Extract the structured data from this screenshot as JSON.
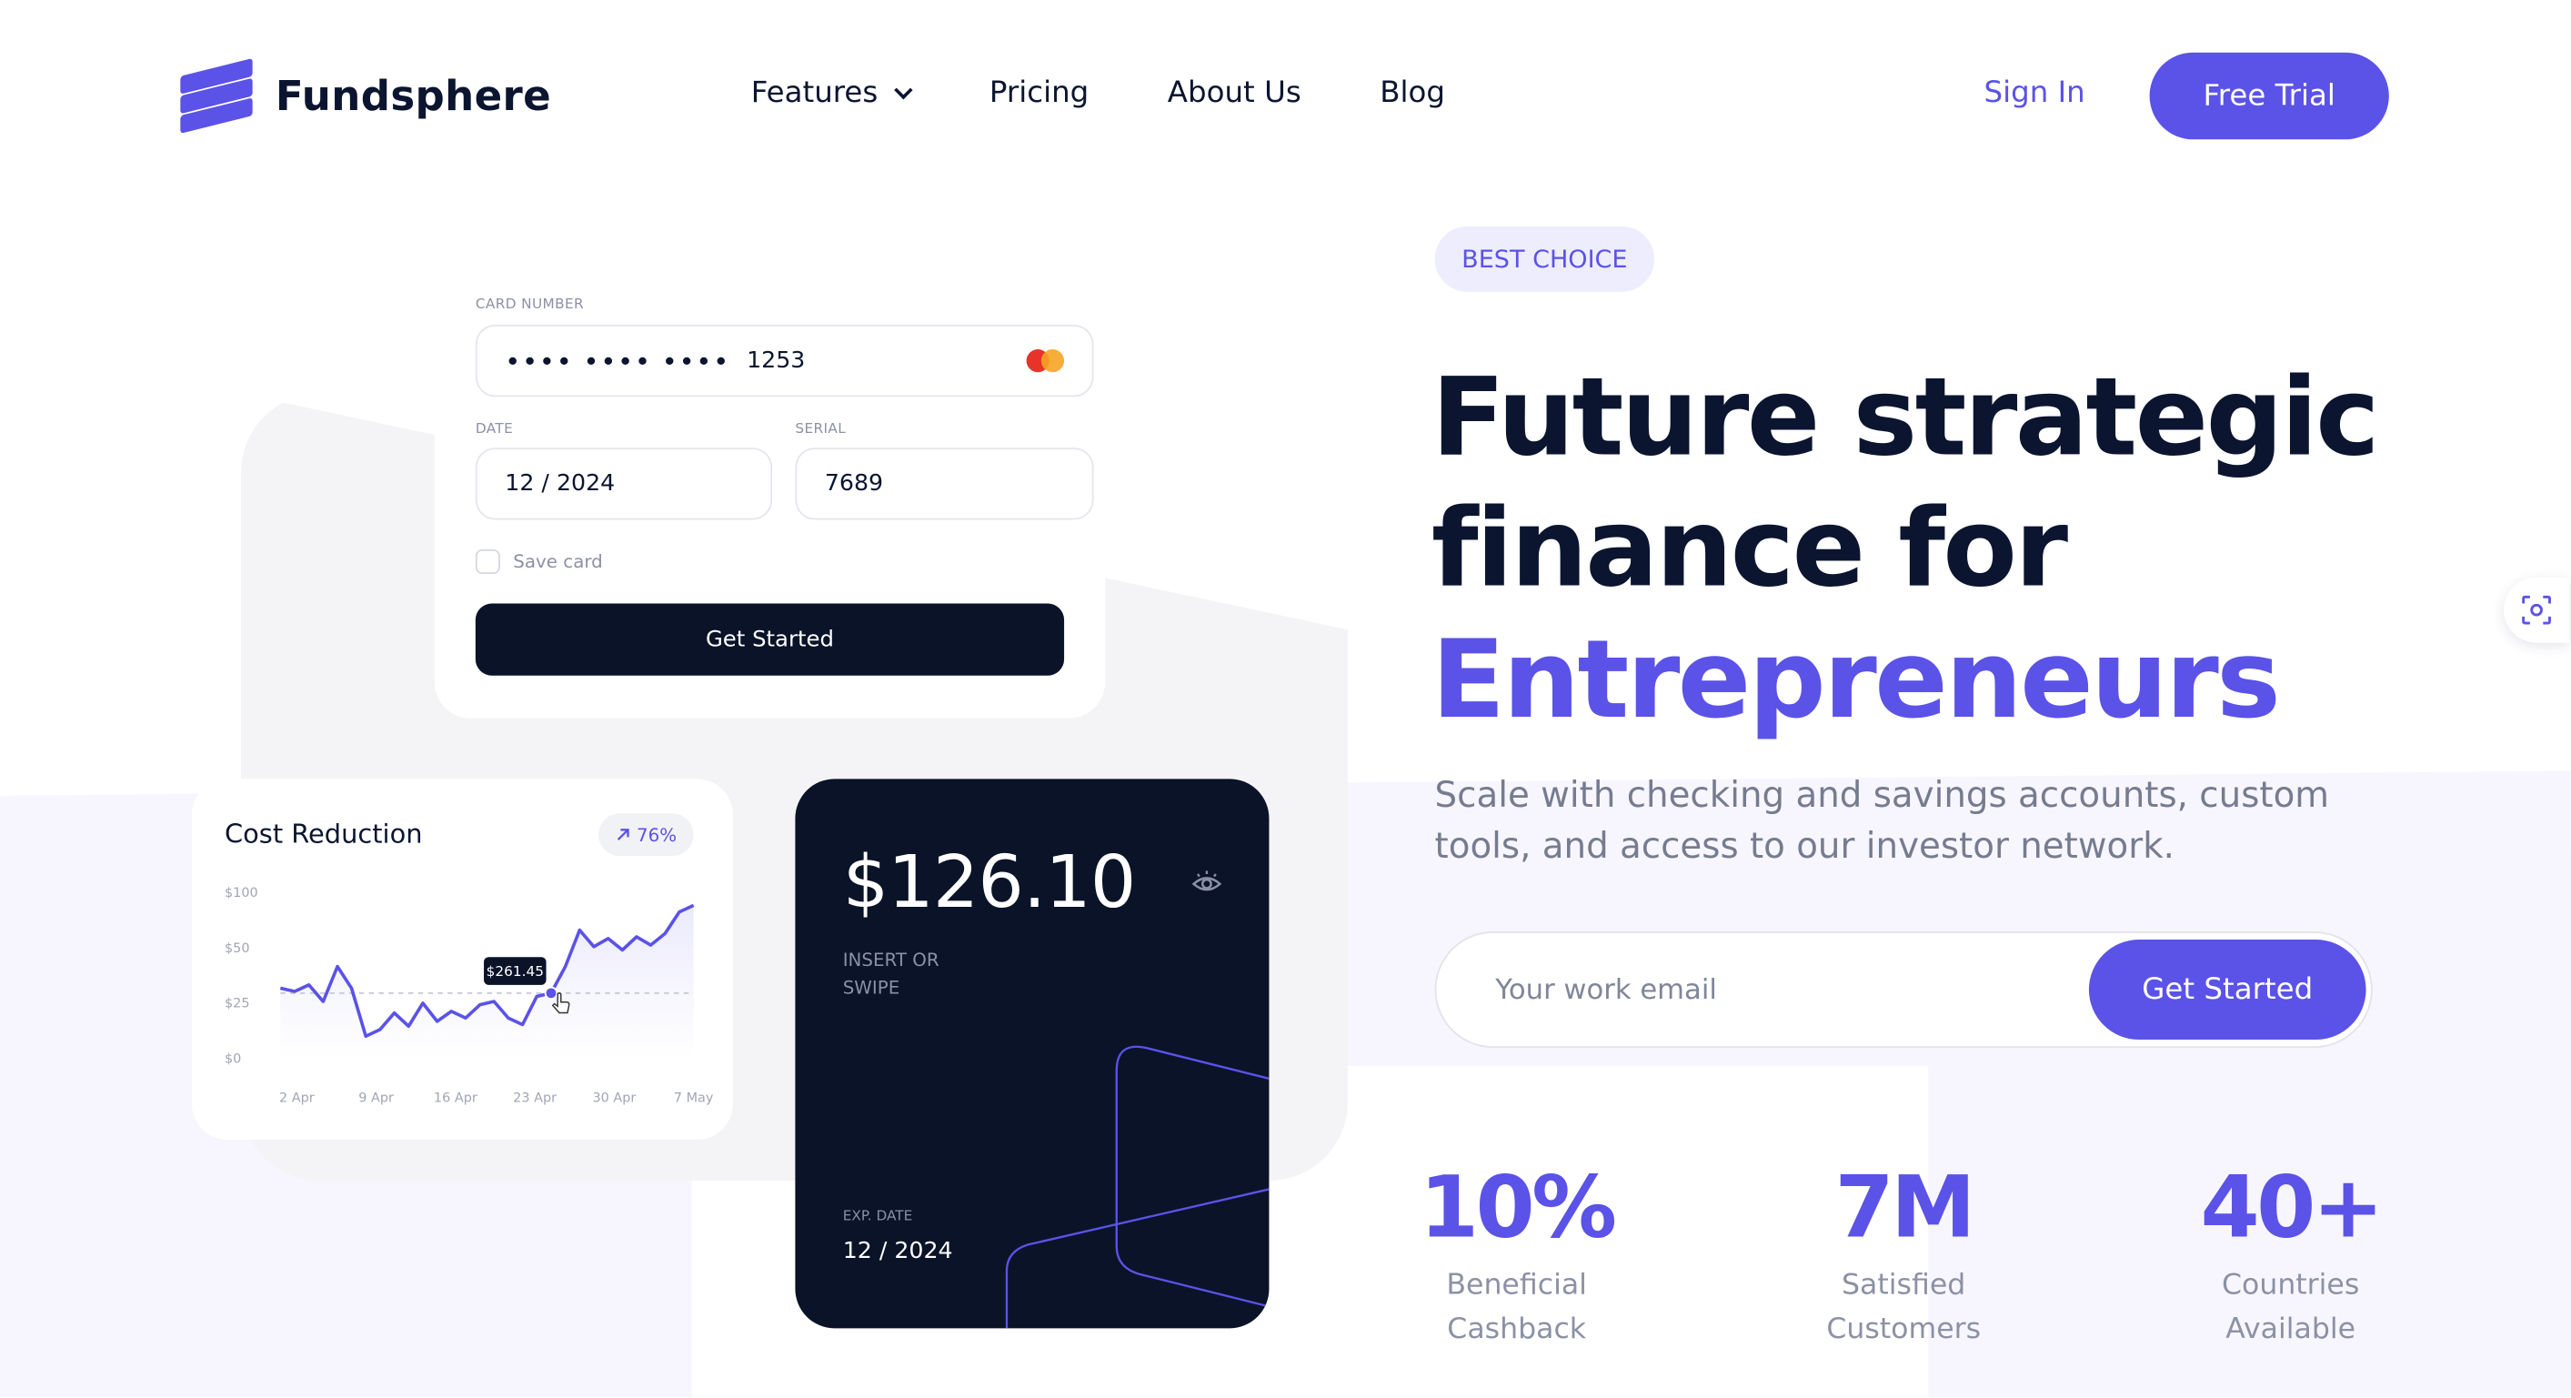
{
  "brand": {
    "name": "Fundsphere",
    "accent": "#5b52e8",
    "dark": "#0a1328"
  },
  "nav": {
    "items": [
      {
        "label": "Features",
        "has_dropdown": true
      },
      {
        "label": "Pricing"
      },
      {
        "label": "About Us"
      },
      {
        "label": "Blog"
      }
    ],
    "sign_in": "Sign In",
    "free_trial": "Free Trial"
  },
  "card_form": {
    "card_number_label": "CARD NUMBER",
    "card_masked": "•••• •••• ••••",
    "card_last4": "1253",
    "date_label": "DATE",
    "date_value": "12 / 2024",
    "serial_label": "SERIAL",
    "serial_value": "7689",
    "save_card_label": "Save card",
    "save_card_checked": false,
    "submit_label": "Get Started",
    "card_brand_icon": "mastercard-icon"
  },
  "cost_card": {
    "title": "Cost Reduction",
    "badge": "76%",
    "badge_icon": "arrow-up-right-icon",
    "tooltip": "$261.45"
  },
  "chart_data": {
    "type": "line",
    "title": "Cost Reduction",
    "y_ticks": [
      "$100",
      "$50",
      "$25",
      "$0"
    ],
    "x_ticks": [
      "2 Apr",
      "9 Apr",
      "16 Apr",
      "23 Apr",
      "30 Apr",
      "7 May"
    ],
    "series": [
      {
        "values": [
          42,
          40,
          44,
          34,
          55,
          42,
          13,
          17,
          27,
          19,
          33,
          22,
          28,
          24,
          32,
          34,
          24,
          20,
          37,
          39,
          55,
          77,
          67,
          72,
          65,
          73,
          68,
          75,
          88,
          92
        ]
      }
    ],
    "highlight": {
      "label": "$261.45",
      "index": 19
    },
    "ylim": [
      0,
      100
    ],
    "grid": true
  },
  "balance_card": {
    "amount": "$126.10",
    "insert_text": "INSERT OR SWIPE",
    "exp_label": "EXP. DATE",
    "exp_value": "12 / 2024",
    "visibility_icon": "eye-icon"
  },
  "hero": {
    "badge": "BEST CHOICE",
    "title_line1": "Future strategic",
    "title_line2": "finance for",
    "title_accent": "Entrepreneurs",
    "subtitle": "Scale with checking and savings accounts, custom tools, and access to our investor network.",
    "email_placeholder": "Your work email",
    "email_value": "",
    "cta": "Get Started"
  },
  "stats": [
    {
      "value": "10%",
      "caption_line1": "Beneficial",
      "caption_line2": "Cashback"
    },
    {
      "value": "7M",
      "caption_line1": "Satisfied",
      "caption_line2": "Customers"
    },
    {
      "value": "40+",
      "caption_line1": "Countries",
      "caption_line2": "Available"
    }
  ],
  "side_tool": {
    "icon": "screenshot-focus-icon"
  }
}
